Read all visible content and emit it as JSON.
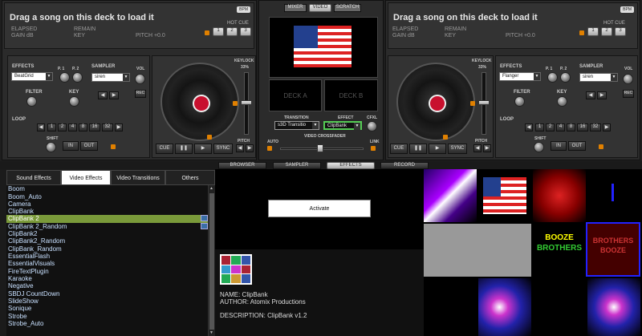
{
  "left_deck": {
    "title": "Drag a song on this deck to load it",
    "elapsed": "ELAPSED",
    "gain": "GAIN dB",
    "remain": "REMAIN",
    "key": "KEY",
    "pitch": "PITCH +0.0",
    "bpm": "BPM",
    "hot_cue": "HOT CUE",
    "hotcues": [
      "1",
      "2",
      "3"
    ],
    "effects_label": "EFFECTS",
    "effect_value": "BeatGrid",
    "p1": "P. 1",
    "p2": "P. 2",
    "sampler_label": "SAMPLER",
    "sampler_value": "siren",
    "vol": "VOL",
    "filter": "FILTER",
    "key_label": "KEY",
    "rec": "REC",
    "loop": "LOOP",
    "loop_sizes": [
      "1",
      "2",
      "4",
      "8",
      "16",
      "32"
    ],
    "shift": "SHIFT",
    "in": "IN",
    "out": "OUT",
    "keylock": "KEYLOCK",
    "keylock_pct": "33%",
    "cue": "CUE",
    "sync": "SYNC",
    "pitch_label": "PITCH"
  },
  "right_deck": {
    "title": "Drag a song on this deck to load it",
    "elapsed": "ELAPSED",
    "gain": "GAIN dB",
    "remain": "REMAIN",
    "key": "KEY",
    "pitch": "PITCH +0.0",
    "bpm": "BPM",
    "hot_cue": "HOT CUE",
    "hotcues": [
      "1",
      "2",
      "3"
    ],
    "effects_label": "EFFECTS",
    "effect_value": "Flanger",
    "p1": "P. 1",
    "p2": "P. 2",
    "sampler_label": "SAMPLER",
    "sampler_value": "siren",
    "vol": "VOL",
    "filter": "FILTER",
    "key_label": "KEY",
    "rec": "REC",
    "loop": "LOOP",
    "loop_sizes": [
      "1",
      "2",
      "4",
      "8",
      "16",
      "32"
    ],
    "shift": "SHIFT",
    "in": "IN",
    "out": "OUT",
    "keylock": "KEYLOCK",
    "keylock_pct": "33%",
    "cue": "CUE",
    "sync": "SYNC",
    "pitch_label": "PITCH"
  },
  "center": {
    "modes": [
      "MIXER",
      "VIDEO",
      "SCRATCH"
    ],
    "deck_a": "DECK A",
    "deck_b": "DECK B",
    "transition_label": "TRANSITION",
    "transition_value": "s3D Transitio",
    "effect_label": "EFFECT",
    "effect_value": "ClipBank",
    "cfxl": "CFXL",
    "auto": "AUTO",
    "link": "LINK",
    "crossfader": "VIDEO CROSSFADER"
  },
  "bottom_tabs": [
    "BROWSER",
    "SAMPLER",
    "EFFECTS",
    "RECORD"
  ],
  "fx_tabs": [
    "Sound Effects",
    "Video Effects",
    "Video Transitions",
    "Others"
  ],
  "fx_list": [
    "Boom",
    "Boom_Auto",
    "Camera",
    "ClipBank",
    "ClipBank 2",
    "ClipBank 2_Random",
    "ClipBank2",
    "ClipBank2_Random",
    "ClipBank_Random",
    "EssentialFlash",
    "EssentialVisuals",
    "FireTextPlugin",
    "Karaoke",
    "Negative",
    "SBDJ CountDown",
    "SlideShow",
    "Sonique",
    "Strobe",
    "Strobe_Auto"
  ],
  "activate": "Activate",
  "details": {
    "name": "NAME: ClipBank",
    "author": "AUTHOR: Atomix Productions",
    "description": "DESCRIPTION: ClipBank v1.2"
  },
  "thumb_texts": {
    "booze1": "BOOZE",
    "booze2": "BROTHERS",
    "bb1": "BROTHERS",
    "bb2": "BOOZE"
  },
  "colors": {
    "accent": "#7a9a3a",
    "selected_row": "#7a9a3a",
    "link_blue": "#c8e0ff"
  }
}
